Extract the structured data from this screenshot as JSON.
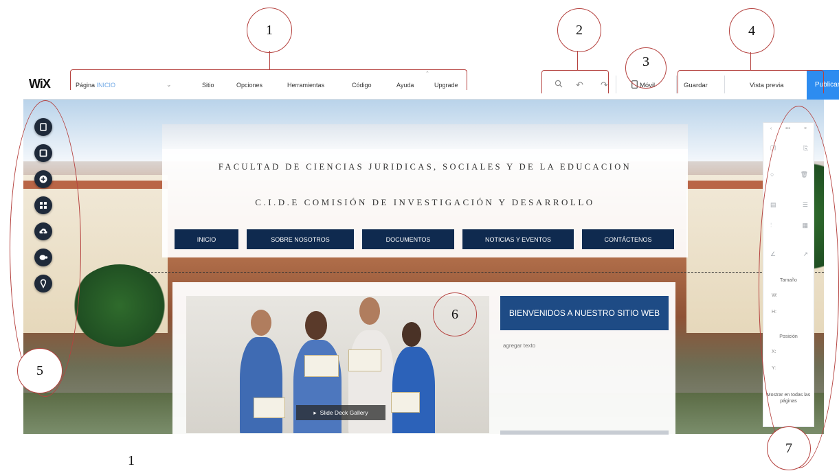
{
  "topbar": {
    "logo": "WiX",
    "page_label": "Página",
    "page_name": "INICIO",
    "menus": [
      "Sitio",
      "Opciones",
      "Herramientas",
      "Código",
      "Ayuda",
      "Upgrade"
    ],
    "mobile_label": "Móvil",
    "save_label": "Guardar",
    "preview_label": "Vista previa",
    "publish_label": "Publicar"
  },
  "site": {
    "title_line1": "FACULTAD DE CIENCIAS JURIDICAS, SOCIALES Y DE LA EDUCACION",
    "title_line2": "C.I.D.E COMISIÓN DE INVESTIGACIÓN Y DESARROLLO",
    "nav": [
      "INICIO",
      "SOBRE NOSOTROS",
      "DOCUMENTOS",
      "NOTICIAS Y EVENTOS",
      "CONTÁCTENOS"
    ],
    "gallery_label": "Slide Deck Gallery",
    "welcome": "BIENVENIDOS A NUESTRO SITIO WEB",
    "add_text": "agregar texto"
  },
  "inspector": {
    "size_label": "Tamaño",
    "w_label": "W:",
    "h_label": "H:",
    "position_label": "Posición",
    "x_label": "X:",
    "y_label": "Y:",
    "show_all": "Mostrar en todas las páginas"
  },
  "callouts": [
    "1",
    "2",
    "3",
    "4",
    "5",
    "6",
    "7"
  ],
  "figure_number": "1",
  "colors": {
    "annotation": "#b5423f",
    "publish": "#2d8cf0",
    "nav_bg": "#0f2a4f",
    "welcome_bg": "#1e4b85",
    "rail_btn": "#1f2a3a"
  },
  "icons": [
    "zoom-icon",
    "undo-icon",
    "redo-icon",
    "mobile-icon",
    "pages-icon",
    "background-icon",
    "add-icon",
    "apps-icon",
    "upload-icon",
    "blog-icon",
    "bookings-icon"
  ]
}
